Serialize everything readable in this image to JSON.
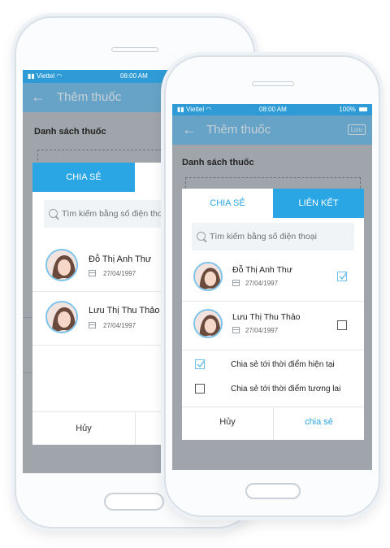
{
  "status": {
    "carrier": "Viettel",
    "time": "08:00 AM",
    "battery": "100%"
  },
  "appbar": {
    "back_icon": "←",
    "title": "Thêm thuốc",
    "save_label": "Lưu"
  },
  "list_title": "Danh sách thuốc",
  "back_dialog": {
    "tab_share": "CHIA SẺ",
    "search_placeholder": "Tìm kiếm bằng số điện thoại",
    "contacts": [
      {
        "name": "Đỗ Thị Anh Thư",
        "dob": "27/04/1997"
      },
      {
        "name": "Lưu Thị Thu Thảo",
        "dob": "27/04/1997"
      }
    ],
    "cancel_label": "Hủy"
  },
  "front_dialog": {
    "tab_share": "CHIA SẺ",
    "tab_link": "LIÊN KẾT",
    "search_placeholder": "Tìm kiếm bằng số điện thoại",
    "contacts": [
      {
        "name": "Đỗ Thị Anh Thư",
        "dob": "27/04/1997",
        "checked": true
      },
      {
        "name": "Lưu Thị Thu Thảo",
        "dob": "27/04/1997",
        "checked": false
      }
    ],
    "options": [
      {
        "label": "Chia sẻ tới thời điểm hiện tại",
        "checked": true
      },
      {
        "label": "Chia sẻ tới thời điểm tương lai",
        "checked": false
      }
    ],
    "cancel_label": "Hủy",
    "share_label": "chia sẻ"
  },
  "colors": {
    "accent": "#2aa6e4",
    "statusbar": "#2f9bd6",
    "overlay": "#9fa5ab"
  }
}
